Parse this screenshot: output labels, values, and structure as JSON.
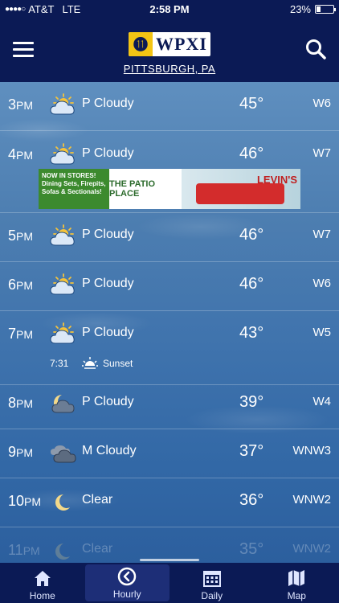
{
  "status": {
    "carrier": "AT&T",
    "network": "LTE",
    "time": "2:58 PM",
    "battery": "23%",
    "battery_level": 0.23
  },
  "header": {
    "logo": "WPXI",
    "location": "PITTSBURGH, PA"
  },
  "hours": [
    {
      "hour": "3",
      "ampm": "PM",
      "icon": "partly-cloudy-day-icon",
      "condition": "P Cloudy",
      "temp": "45°",
      "wind": "W6"
    },
    {
      "hour": "4",
      "ampm": "PM",
      "icon": "partly-cloudy-day-icon",
      "condition": "P Cloudy",
      "temp": "46°",
      "wind": "W7"
    },
    {
      "hour": "5",
      "ampm": "PM",
      "icon": "partly-cloudy-day-icon",
      "condition": "P Cloudy",
      "temp": "46°",
      "wind": "W7"
    },
    {
      "hour": "6",
      "ampm": "PM",
      "icon": "partly-cloudy-day-icon",
      "condition": "P Cloudy",
      "temp": "46°",
      "wind": "W6"
    },
    {
      "hour": "7",
      "ampm": "PM",
      "icon": "partly-cloudy-day-icon",
      "condition": "P Cloudy",
      "temp": "43°",
      "wind": "W5"
    },
    {
      "hour": "8",
      "ampm": "PM",
      "icon": "partly-cloudy-night-icon",
      "condition": "P Cloudy",
      "temp": "39°",
      "wind": "W4"
    },
    {
      "hour": "9",
      "ampm": "PM",
      "icon": "mostly-cloudy-night-icon",
      "condition": "M Cloudy",
      "temp": "37°",
      "wind": "WNW3"
    },
    {
      "hour": "10",
      "ampm": "PM",
      "icon": "moon-icon",
      "condition": "Clear",
      "temp": "36°",
      "wind": "WNW2"
    },
    {
      "hour": "11",
      "ampm": "PM",
      "icon": "moon-icon",
      "condition": "Clear",
      "temp": "35°",
      "wind": "WNW2"
    }
  ],
  "sunset": {
    "time": "7:31",
    "label": "Sunset"
  },
  "ad": {
    "promo": "NOW IN STORES! Dining Sets, Firepits, Sofas & Sectionals!",
    "store": "THE PATIO PLACE",
    "brand": "LEVIN'S"
  },
  "tabs": [
    {
      "label": "Home",
      "icon": "home-icon"
    },
    {
      "label": "Hourly",
      "icon": "clock-icon"
    },
    {
      "label": "Daily",
      "icon": "calendar-icon"
    },
    {
      "label": "Map",
      "icon": "map-icon"
    }
  ],
  "colors": {
    "header_bg": "#0b1a55",
    "tab_active_bg": "#1d2e77",
    "logo_gold": "#f3c414"
  }
}
